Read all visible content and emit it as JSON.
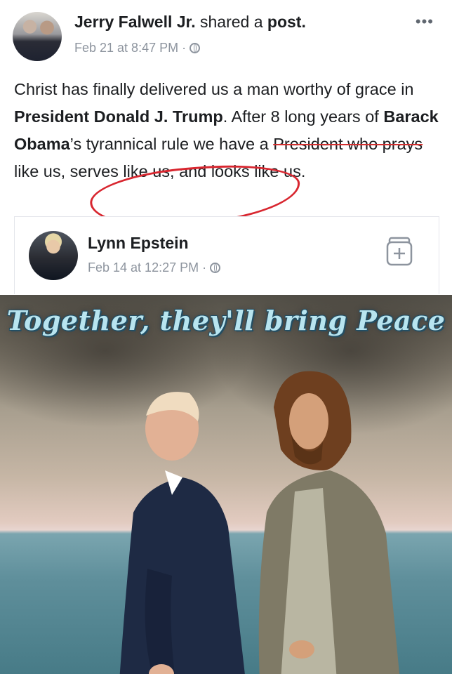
{
  "post": {
    "author": "Jerry Falwell Jr.",
    "action": " shared a ",
    "object": "post.",
    "date": "Feb 21 at 8:47 PM",
    "separator": "·",
    "more": "•••",
    "text_parts": [
      {
        "t": "Christ has finally delivered us a man worthy of grace in ",
        "b": false
      },
      {
        "t": "President Donald J. Trump",
        "b": true
      },
      {
        "t": ". After 8 long years of ",
        "b": false
      },
      {
        "t": "Barack Obama",
        "b": true
      },
      {
        "t": "’s tyrannical rule we have a ",
        "b": false
      },
      {
        "t": "President who prays",
        "b": false,
        "strike": true
      },
      {
        "t": " like us, serves like us, and looks like us.",
        "b": false
      }
    ]
  },
  "shared": {
    "author": "Lynn Epstein",
    "date": "Feb 14 at 12:27 PM",
    "separator": "·"
  },
  "image": {
    "caption": "Together, they'll bring Peace"
  },
  "icons": [
    "globe-icon",
    "more-icon",
    "save-icon"
  ],
  "colors": {
    "annotation": "#d8262f",
    "meta": "#8d949e",
    "caption": "#b8e4ef"
  }
}
